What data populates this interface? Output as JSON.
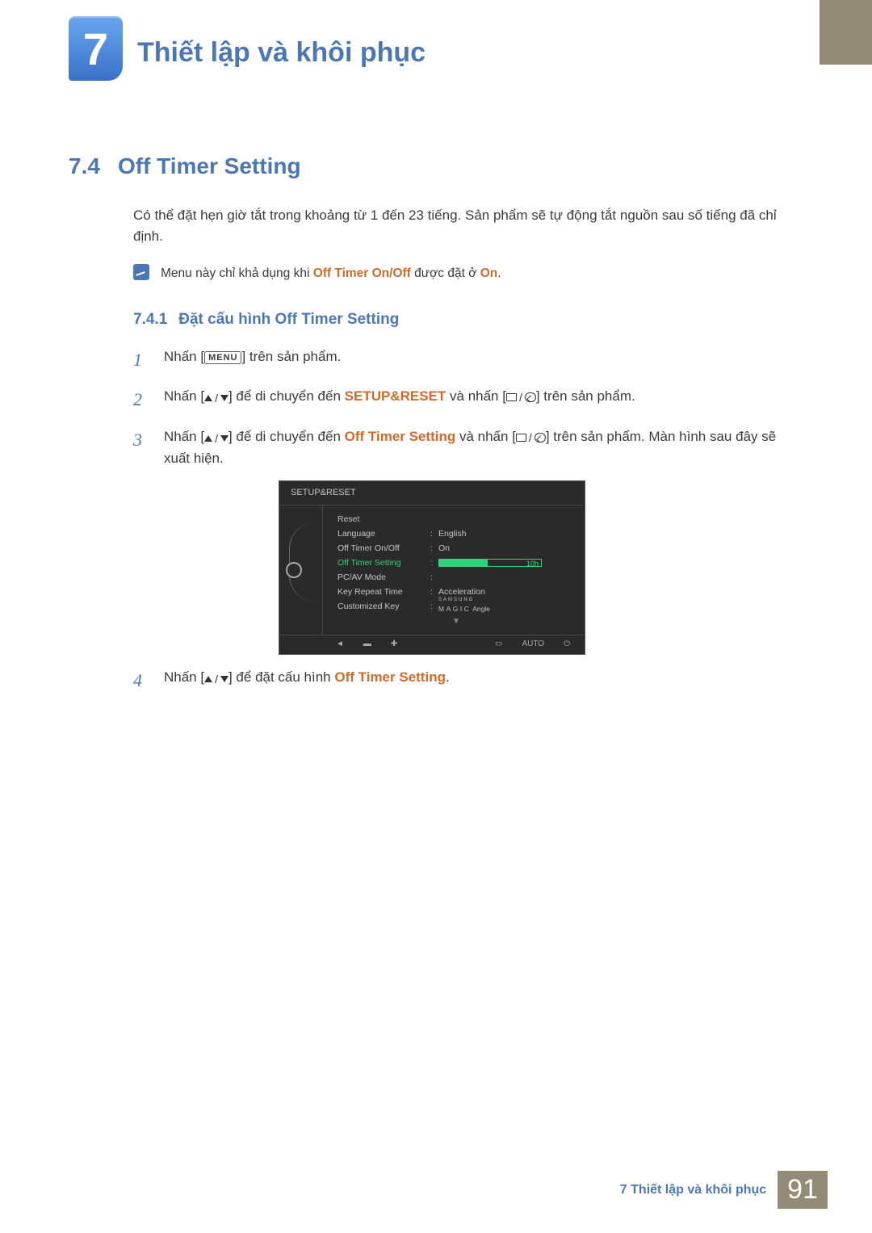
{
  "chapter": {
    "number": "7",
    "title": "Thiết lập và khôi phục"
  },
  "section": {
    "number": "7.4",
    "title": "Off Timer Setting"
  },
  "intro": "Có thể đặt hẹn giờ tắt trong khoảng từ 1 đến 23 tiếng. Sản phẩm sẽ tự động tắt nguồn sau số tiếng đã chỉ định.",
  "note": {
    "pre": "Menu này chỉ khả dụng khi ",
    "em1": "Off Timer On/Off",
    "mid": " được đặt ở ",
    "em2": "On",
    "post": "."
  },
  "subsection": {
    "number": "7.4.1",
    "title": "Đặt cấu hình Off Timer Setting"
  },
  "steps": {
    "s1": {
      "num": "1",
      "pre": "Nhấn [",
      "menu": "MENU",
      "post": "] trên sản phẩm."
    },
    "s2": {
      "num": "2",
      "pre": "Nhấn [",
      "mid1": "] để di chuyển đến ",
      "em": "SETUP&RESET",
      "mid2": " và nhấn [",
      "post": "] trên sản phẩm."
    },
    "s3": {
      "num": "3",
      "pre": "Nhấn [",
      "mid1": "] để di chuyển đến ",
      "em": "Off Timer Setting",
      "mid2": " và nhấn [",
      "post": "] trên sản phẩm. Màn hình sau đây sẽ xuất hiện."
    },
    "s4": {
      "num": "4",
      "pre": "Nhấn [",
      "mid": "] để đặt cấu hình ",
      "em": "Off Timer Setting",
      "post": "."
    }
  },
  "osd": {
    "title": "SETUP&RESET",
    "rows": {
      "reset": {
        "label": "Reset",
        "value": ""
      },
      "language": {
        "label": "Language",
        "value": "English"
      },
      "onoff": {
        "label": "Off Timer On/Off",
        "value": "On"
      },
      "setting": {
        "label": "Off Timer Setting",
        "bar_value": "10h"
      },
      "pcav": {
        "label": "PC/AV Mode",
        "value": ""
      },
      "keyrepeat": {
        "label": "Key Repeat Time",
        "value": "Acceleration"
      },
      "customkey": {
        "label": "Customized Key",
        "magic_sup": "SAMSUNG",
        "magic_main": "MAGIC",
        "magic_tail": " Angle"
      }
    },
    "footer": {
      "auto": "AUTO"
    }
  },
  "footer": {
    "crumb": "7 Thiết lập và khôi phục",
    "page": "91"
  }
}
